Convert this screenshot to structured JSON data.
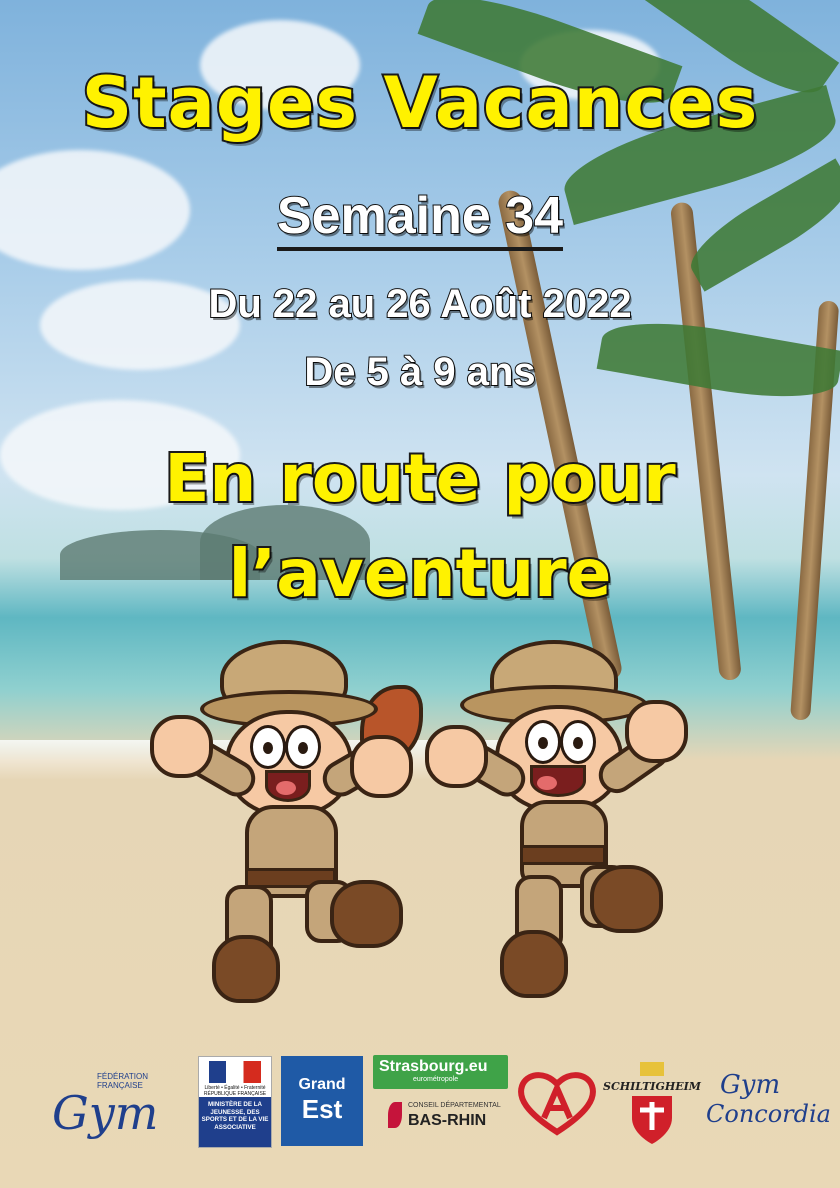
{
  "poster": {
    "title": "Stages Vacances",
    "week": "Semaine 34",
    "dates": "Du 22 au 26 Août 2022",
    "ages": "De 5 à 9 ans",
    "theme_line1": "En route pour",
    "theme_line2": "l’aventure"
  },
  "colors": {
    "title_yellow": "#fff200",
    "outline": "#1a1a1a",
    "logo_blue": "#1f3f8c",
    "grand_est_blue": "#1f5aa6",
    "strasbourg_green": "#3fa348",
    "alsace_red": "#d0202a"
  },
  "logos": {
    "ffg_small": "FÉDÉRATION FRANÇAISE",
    "ffg_big": "Gym",
    "ministere_republic": "Liberté • Égalité • Fraternité RÉPUBLIQUE FRANÇAISE",
    "ministere_text": "MINISTÈRE DE LA JEUNESSE, DES SPORTS ET DE LA VIE ASSOCIATIVE",
    "grand_est_1": "Grand",
    "grand_est_2": "Est",
    "strasbourg_1": "Strasbourg.eu",
    "strasbourg_2": "eurométropole",
    "bas_rhin_1": "CONSEIL DÉPARTEMENTAL",
    "bas_rhin_2": "BAS-RHIN",
    "schiltigheim": "SCHILTIGHEIM",
    "gym_concordia_1": "Gym",
    "gym_concordia_2": "Concordia"
  }
}
